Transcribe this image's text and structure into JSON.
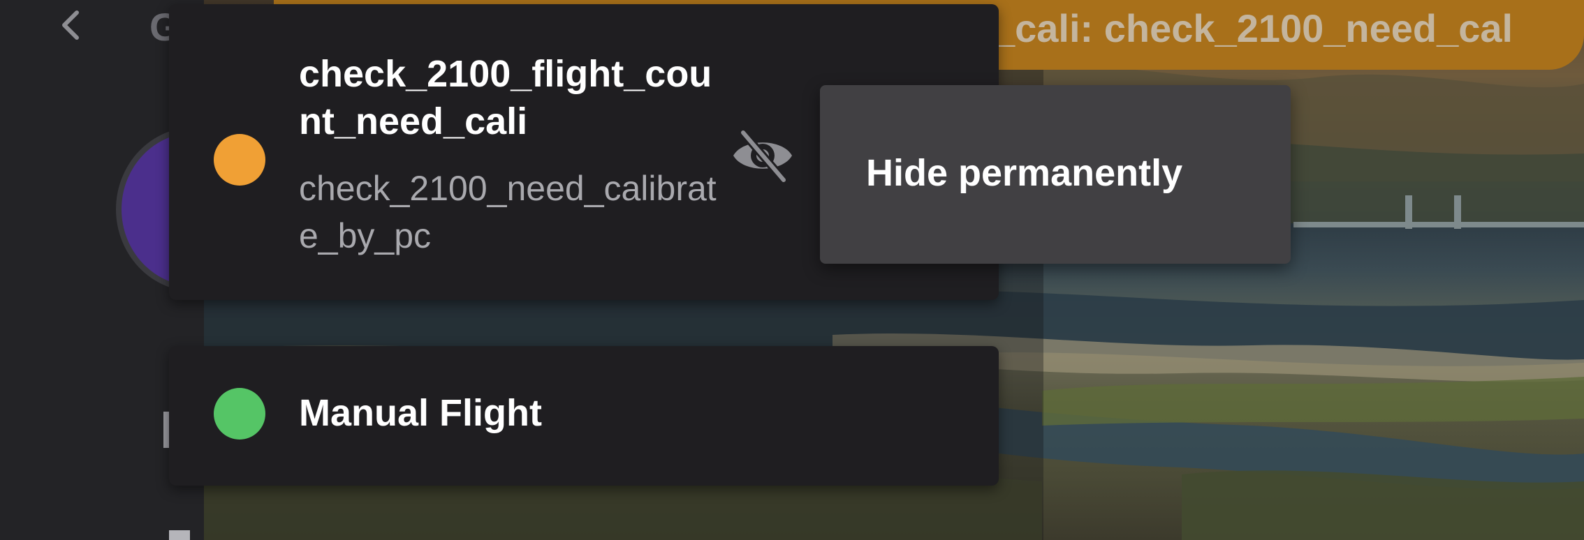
{
  "banner": {
    "text": "_cali: check_2100_need_cal"
  },
  "left_rail": {
    "letter": "G"
  },
  "alerts": [
    {
      "title": "check_2100_flight_count_need_cali",
      "subtitle": "check_2100_need_calibrate_by_pc",
      "status_color": "#f0a035",
      "icon": "eye-slash-icon"
    },
    {
      "title": "Manual Flight",
      "status_color": "#55c566"
    }
  ],
  "popup": {
    "item_label": "Hide permanently"
  },
  "colors": {
    "banner": "#a8701a",
    "card_bg": "#1f1e21",
    "popup_bg": "#414043"
  }
}
